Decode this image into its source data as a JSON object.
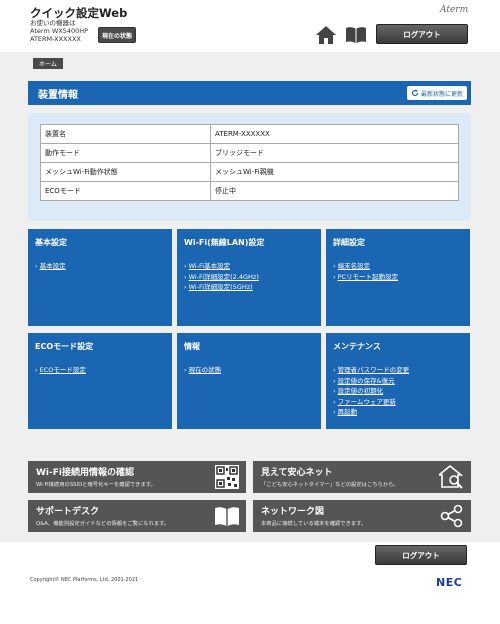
{
  "header": {
    "app_title": "クイック設定Web",
    "device_lines": [
      "お使いの機器は",
      "Aterm WX5400HP",
      "ATERM-XXXXXX"
    ],
    "status_button": "現在の状態",
    "brand": "Aterm",
    "logout": "ログアウト"
  },
  "breadcrumb": {
    "home": "ホーム"
  },
  "section": {
    "title": "装置情報",
    "refresh": "最新状態に更新"
  },
  "info_rows": [
    {
      "key": "装置名",
      "value": "ATERM-XXXXXX"
    },
    {
      "key": "動作モード",
      "value": "ブリッジモード"
    },
    {
      "key": "メッシュWi-Fi動作状態",
      "value": "メッシュWi-Fi親機"
    },
    {
      "key": "ECOモード",
      "value": "停止中"
    }
  ],
  "tiles": [
    {
      "title": "基本設定",
      "links": [
        "基本設定"
      ]
    },
    {
      "title": "Wi-Fi(無線LAN)設定",
      "links": [
        "Wi-Fi基本設定",
        "Wi-Fi詳細設定(2.4GHz)",
        "Wi-Fi詳細設定(5GHz)"
      ]
    },
    {
      "title": "詳細設定",
      "links": [
        "端末名設定",
        "PCリモート起動設定"
      ]
    },
    {
      "title": "ECOモード設定",
      "links": [
        "ECOモード設定"
      ]
    },
    {
      "title": "情報",
      "links": [
        "現在の状態"
      ]
    },
    {
      "title": "メンテナンス",
      "links": [
        "管理者パスワードの変更",
        "設定値の保存&復元",
        "設定値の初期化",
        "ファームウェア更新",
        "再起動"
      ]
    }
  ],
  "bottom_tiles": [
    {
      "title": "Wi-Fi接続用情報の確認",
      "desc": "Wi-Fi接続用のSSIDと暗号化キーを確認できます。",
      "icon": "qr-code-icon"
    },
    {
      "title": "見えて安心ネット",
      "desc": "「こども安心ネットタイマー」などの設定はこちらから。",
      "icon": "house-search-icon"
    },
    {
      "title": "サポートデスク",
      "desc": "Q&A、機能別設定ガイドなどの情報をご覧になれます。",
      "icon": "open-book-icon"
    },
    {
      "title": "ネットワーク図",
      "desc": "本商品に接続している端末を確認できます。",
      "icon": "network-icon"
    }
  ],
  "footer": {
    "logout": "ログアウト",
    "copyright": "Copyright© NEC Platforms, Ltd. 2001-2021",
    "nec": "NEC"
  },
  "colors": {
    "accent": "#1b66b3",
    "panel": "#dce9f7",
    "dark_button": "#4a4a4a",
    "tile_dark": "#555555"
  }
}
